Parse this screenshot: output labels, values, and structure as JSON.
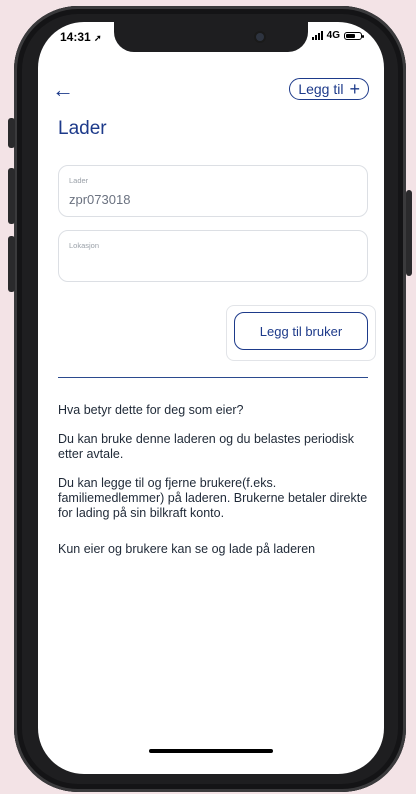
{
  "status_bar": {
    "time": "14:31",
    "network": "4G"
  },
  "header": {
    "add_label": "Legg til"
  },
  "page": {
    "title": "Lader"
  },
  "form": {
    "charger_label": "Lader",
    "charger_value": "zpr073018",
    "location_label": "Lokasjon",
    "location_value": ""
  },
  "actions": {
    "add_user_label": "Legg til bruker"
  },
  "info": {
    "question": "Hva betyr dette for deg som eier?",
    "para1": "Du kan bruke denne laderen og du belastes periodisk etter avtale.",
    "para2": "Du kan legge til og fjerne brukere(f.eks. familiemedlemmer) på laderen. Brukerne betaler direkte for lading på sin bilkraft konto.",
    "para3": "Kun eier og brukere kan se og lade på laderen"
  },
  "icons": {
    "back": "arrow-left-icon",
    "add": "plus-icon",
    "signal": "signal-icon",
    "battery": "battery-icon",
    "location_arrow": "location-arrow-icon"
  },
  "colors": {
    "accent": "#1d3a8a",
    "background": "#f3e3e6"
  }
}
